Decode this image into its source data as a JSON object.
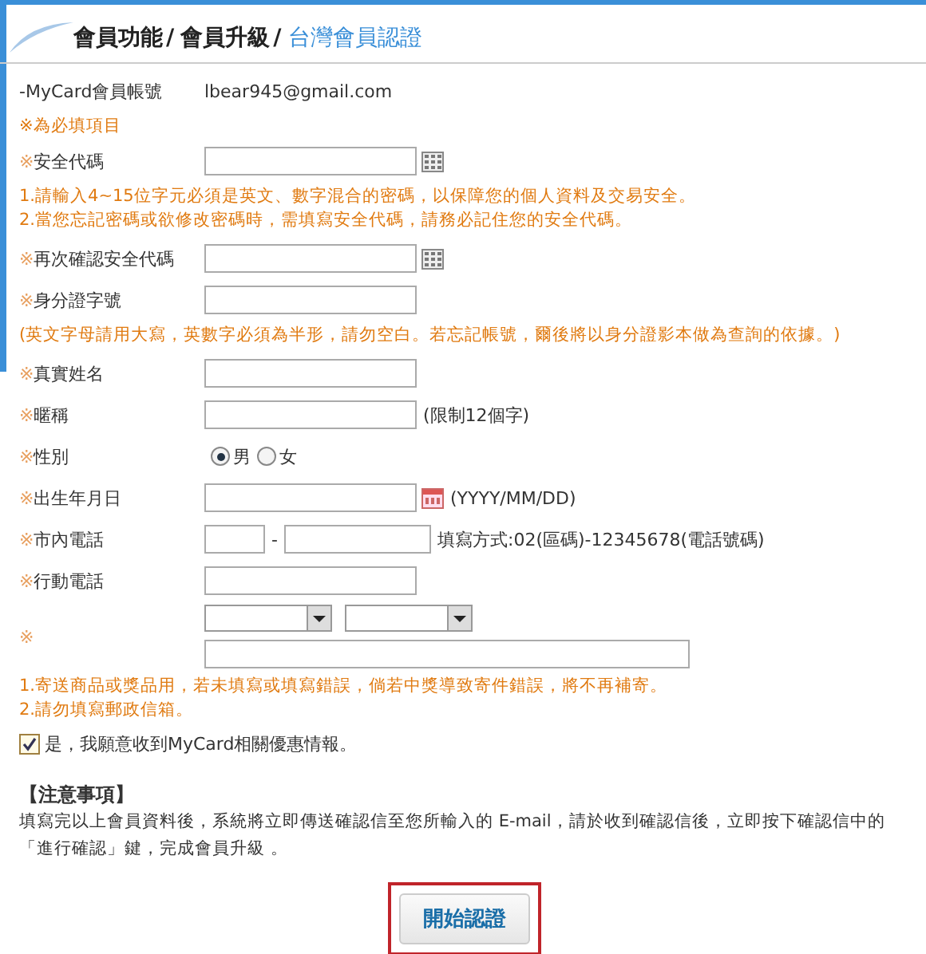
{
  "breadcrumb": [
    {
      "label": "會員功能",
      "current": false
    },
    {
      "separator": "/",
      "label": "會員升級",
      "current": false
    },
    {
      "separator": "/",
      "label": "台灣會員認證",
      "current": true
    }
  ],
  "account": {
    "label": "-MyCard會員帳號",
    "value": "lbear945@gmail.com"
  },
  "required_note": "※為必填項目",
  "rows": [
    {
      "kind": "password",
      "mark": "※",
      "label": "安全代碼",
      "notes": [
        "1.請輸入4~15位字元必須是英文、數字混合的密碼，以保障您的個人資料及交易安全。",
        "2.當您忘記密碼或欲修改密碼時，需填寫安全代碼，請務必記住您的安全代碼。"
      ]
    },
    {
      "kind": "password",
      "mark": "※",
      "label": "再次確認安全代碼"
    },
    {
      "kind": "text",
      "mark": "※",
      "label": "身分證字號",
      "notes": [
        "(英文字母請用大寫，英數字必須為半形，請勿空白。若忘記帳號，爾後將以身分證影本做為查詢的依據。)"
      ]
    },
    {
      "kind": "text",
      "mark": "※",
      "label": "真實姓名"
    },
    {
      "kind": "text",
      "mark": "※",
      "label": "暱稱",
      "hint": "(限制12個字)"
    },
    {
      "kind": "radio",
      "mark": "※",
      "label": "性別",
      "options": [
        {
          "label": "男",
          "selected": true
        },
        {
          "label": "女",
          "selected": false
        }
      ]
    },
    {
      "kind": "date",
      "mark": "※",
      "label": "出生年月日",
      "hint": "(YYYY/MM/DD)"
    },
    {
      "kind": "phone",
      "mark": "※",
      "label": "市內電話",
      "separator": "-",
      "hint": "填寫方式:02(區碼)-12345678(電話號碼)"
    },
    {
      "kind": "text",
      "mark": "※",
      "label": "行動電話"
    },
    {
      "kind": "address",
      "mark": "※",
      "notes": [
        "1.寄送商品或獎品用，若未填寫或填寫錯誤，倘若中獎導致寄件錯誤，將不再補寄。",
        "2.請勿填寫郵政信箱。"
      ]
    }
  ],
  "consent": {
    "label": "是，我願意收到MyCard相關優惠情報。",
    "checked": true
  },
  "notice": {
    "title": "【注意事項】",
    "text": "填寫完以上會員資料後，系統將立即傳送確認信至您所輸入的 E-mail，請於收到確認信後，立即按下確認信中的「進行確認」鍵，完成會員升級 。"
  },
  "submit": "開始認證"
}
